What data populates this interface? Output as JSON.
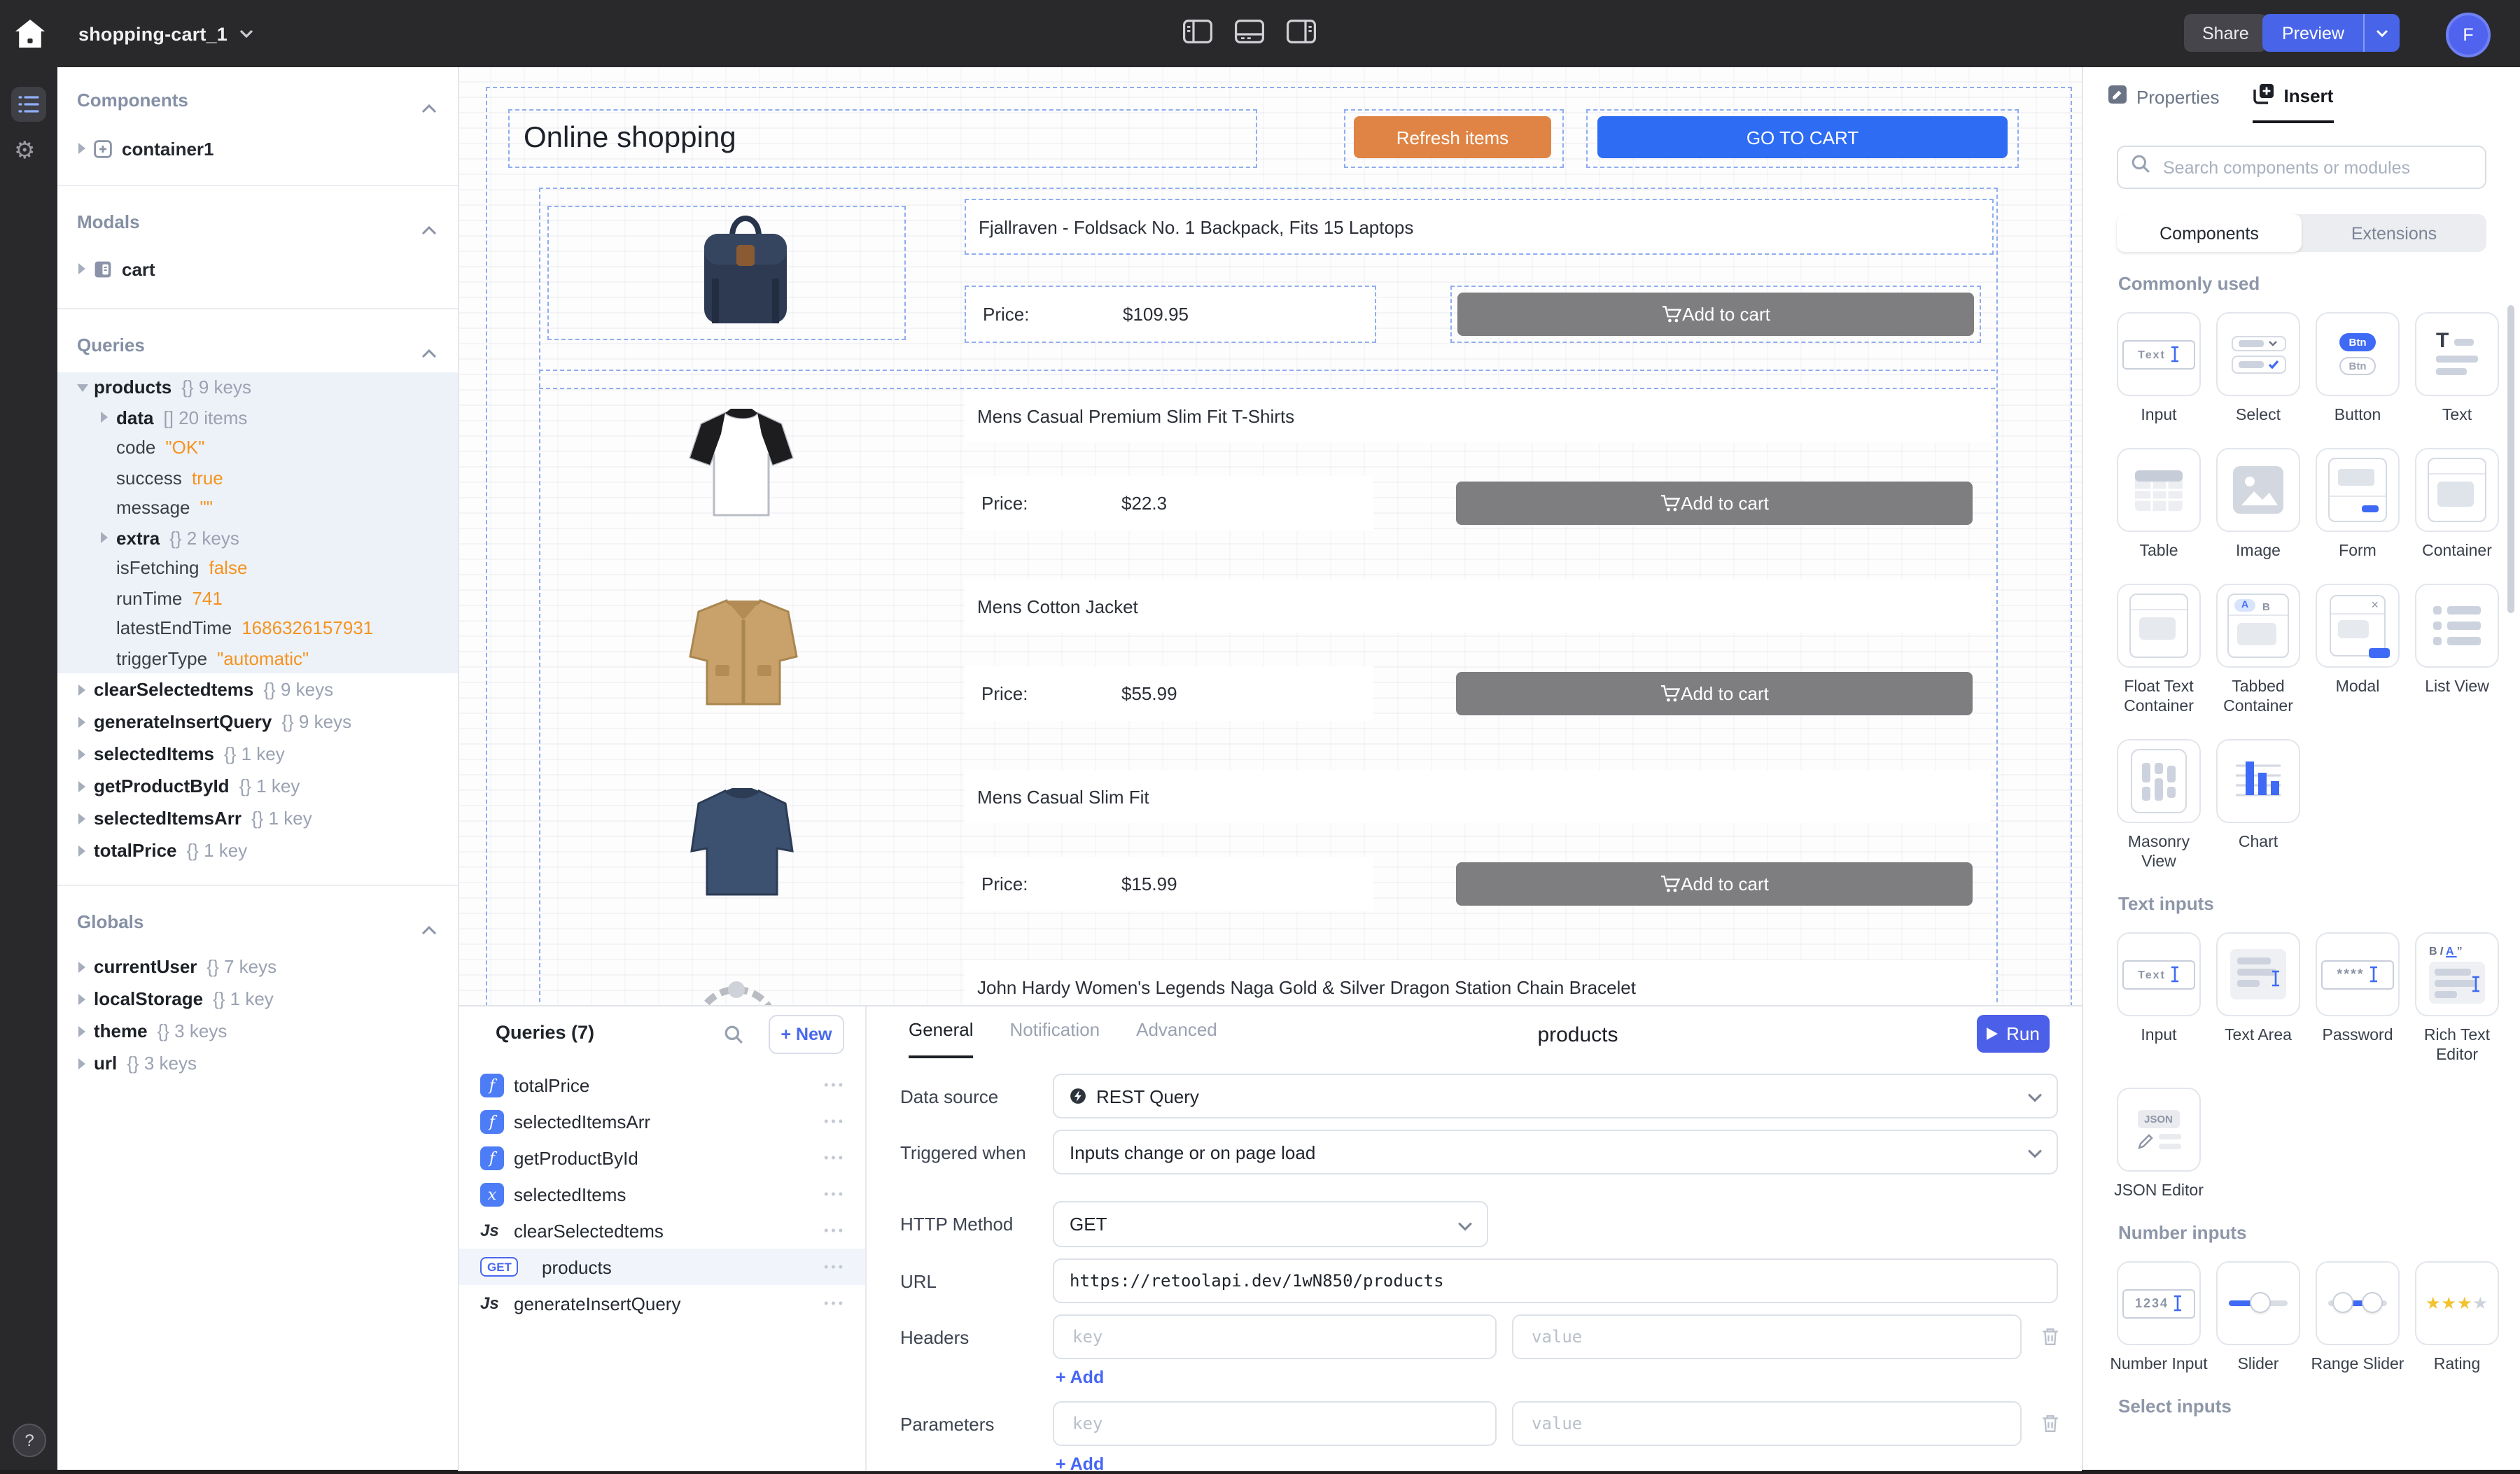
{
  "topbar": {
    "app_name": "shopping-cart_1",
    "share": "Share",
    "preview": "Preview",
    "avatar": "F"
  },
  "sidebar": {
    "sections": {
      "components": "Components",
      "modals": "Modals",
      "queries": "Queries",
      "globals": "Globals"
    },
    "components_items": [
      {
        "label": "container1"
      }
    ],
    "modals_items": [
      {
        "label": "cart"
      }
    ],
    "queries_tree": {
      "root": {
        "label": "products",
        "meta": "{} 9 keys"
      },
      "children": [
        {
          "label": "data",
          "meta": "[] 20 items",
          "bold": true,
          "caret": true
        },
        {
          "label": "code",
          "value": "\"OK\""
        },
        {
          "label": "success",
          "value": "true"
        },
        {
          "label": "message",
          "value": "\"\""
        },
        {
          "label": "extra",
          "meta": "{} 2 keys",
          "bold": true,
          "caret": true
        },
        {
          "label": "isFetching",
          "value": "false"
        },
        {
          "label": "runTime",
          "value": "741"
        },
        {
          "label": "latestEndTime",
          "value": "1686326157931"
        },
        {
          "label": "triggerType",
          "value": "\"automatic\""
        }
      ],
      "siblings": [
        {
          "label": "clearSelectedtems",
          "meta": "{} 9 keys"
        },
        {
          "label": "generateInsertQuery",
          "meta": "{} 9 keys"
        },
        {
          "label": "selectedItems",
          "meta": "{} 1 key"
        },
        {
          "label": "getProductById",
          "meta": "{} 1 key"
        },
        {
          "label": "selectedItemsArr",
          "meta": "{} 1 key"
        },
        {
          "label": "totalPrice",
          "meta": "{} 1 key"
        }
      ]
    },
    "globals_items": [
      {
        "label": "currentUser",
        "meta": "{} 7 keys"
      },
      {
        "label": "localStorage",
        "meta": "{} 1 key"
      },
      {
        "label": "theme",
        "meta": "{} 3 keys"
      },
      {
        "label": "url",
        "meta": "{} 3 keys"
      }
    ]
  },
  "canvas": {
    "title": "Online shopping",
    "refresh_label": "Refresh items",
    "cart_label": "GO TO CART",
    "price_label": "Price:",
    "add_label": "Add to cart",
    "products": [
      {
        "name": "Fjallraven - Foldsack No. 1 Backpack, Fits 15 Laptops",
        "price": "$109.95"
      },
      {
        "name": "Mens Casual Premium Slim Fit T-Shirts",
        "price": "$22.3"
      },
      {
        "name": "Mens Cotton Jacket",
        "price": "$55.99"
      },
      {
        "name": "Mens Casual Slim Fit",
        "price": "$15.99"
      },
      {
        "name": "John Hardy Women's Legends Naga Gold & Silver Dragon Station Chain Bracelet"
      }
    ]
  },
  "qpanel": {
    "header": "Queries (7)",
    "new_label": "+ New",
    "items": [
      {
        "label": "totalPrice",
        "icon": "fx"
      },
      {
        "label": "selectedItemsArr",
        "icon": "fx"
      },
      {
        "label": "getProductById",
        "icon": "fx"
      },
      {
        "label": "selectedItems",
        "icon": "state"
      },
      {
        "label": "clearSelectedtems",
        "icon": "js"
      },
      {
        "label": "products",
        "icon": "get",
        "selected": true
      },
      {
        "label": "generateInsertQuery",
        "icon": "js"
      }
    ],
    "tabs": [
      "General",
      "Notification",
      "Advanced"
    ],
    "title": "products",
    "run_label": "Run",
    "fields": {
      "data_source_label": "Data source",
      "data_source_value": "REST Query",
      "triggered_label": "Triggered when",
      "triggered_value": "Inputs change or on page load",
      "method_label": "HTTP Method",
      "method_value": "GET",
      "url_label": "URL",
      "url_value": "https://retoolapi.dev/1wN850/products",
      "headers_label": "Headers",
      "parameters_label": "Parameters",
      "key_placeholder": "key",
      "value_placeholder": "value",
      "add_label": "+ Add"
    }
  },
  "insert": {
    "properties_tab": "Properties",
    "insert_tab": "Insert",
    "search_placeholder": "Search components or modules",
    "segments": [
      "Components",
      "Extensions"
    ],
    "sections": [
      {
        "title": "Commonly used",
        "items": [
          {
            "label": "Input",
            "glyph": "input"
          },
          {
            "label": "Select",
            "glyph": "select"
          },
          {
            "label": "Button",
            "glyph": "button"
          },
          {
            "label": "Text",
            "glyph": "text"
          },
          {
            "label": "Table",
            "glyph": "table"
          },
          {
            "label": "Image",
            "glyph": "image"
          },
          {
            "label": "Form",
            "glyph": "form"
          },
          {
            "label": "Container",
            "glyph": "container"
          },
          {
            "label": "Float Text Container",
            "glyph": "floattext"
          },
          {
            "label": "Tabbed Container",
            "glyph": "tabbed"
          },
          {
            "label": "Modal",
            "glyph": "modal"
          },
          {
            "label": "List View",
            "glyph": "listview"
          },
          {
            "label": "Masonry View",
            "glyph": "masonry"
          },
          {
            "label": "Chart",
            "glyph": "chart"
          }
        ]
      },
      {
        "title": "Text inputs",
        "items": [
          {
            "label": "Input",
            "glyph": "input"
          },
          {
            "label": "Text Area",
            "glyph": "textarea"
          },
          {
            "label": "Password",
            "glyph": "password"
          },
          {
            "label": "Rich Text Editor",
            "glyph": "richtext"
          },
          {
            "label": "JSON Editor",
            "glyph": "json"
          }
        ]
      },
      {
        "title": "Number inputs",
        "items": [
          {
            "label": "Number Input",
            "glyph": "number"
          },
          {
            "label": "Slider",
            "glyph": "slider"
          },
          {
            "label": "Range Slider",
            "glyph": "range"
          },
          {
            "label": "Rating",
            "glyph": "rating"
          }
        ]
      },
      {
        "title": "Select inputs",
        "items": []
      }
    ]
  },
  "glyphs": {
    "input_text": "Text",
    "btn": "Btn",
    "text_t": "T",
    "tab_a": "A",
    "tab_b": "B",
    "modal_x": "×",
    "password": "****",
    "digits": "1234",
    "json": "JSON",
    "rich_toolbar_b": "B",
    "rich_toolbar_i": "I",
    "rich_toolbar_a": "A",
    "rich_toolbar_q": "”",
    "star": "★"
  },
  "icons": {
    "gear": "⚙",
    "help": "?"
  }
}
